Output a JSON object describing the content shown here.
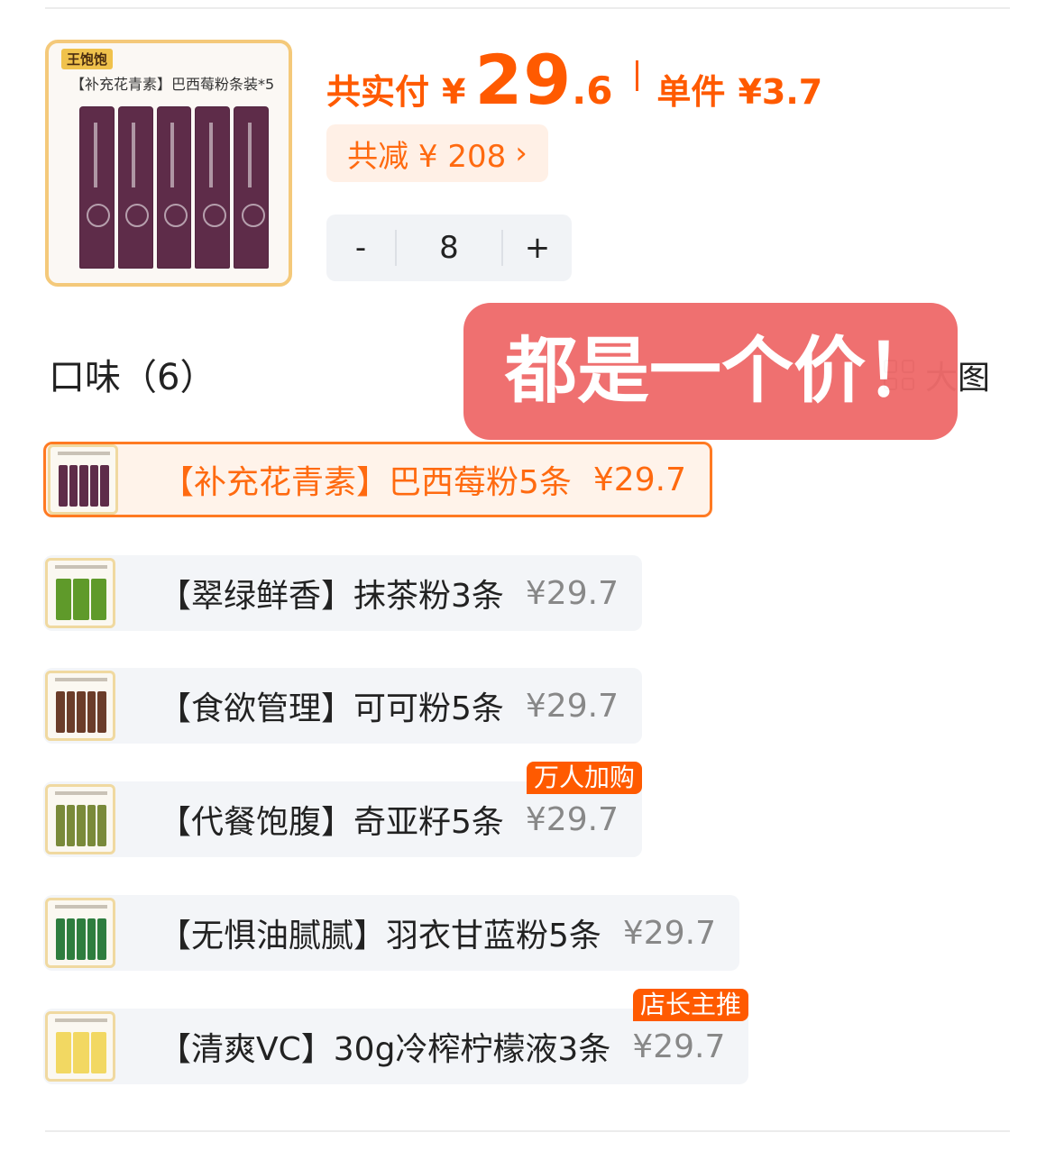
{
  "product": {
    "brand": "王饱饱",
    "image_caption": "【补充花青素】巴西莓粉条装*5",
    "pack_color": "#5e2c49"
  },
  "price": {
    "label": "共实付",
    "currency": "¥",
    "integer": "29",
    "decimal": ".6",
    "unit_label": "单件",
    "unit_price": "¥3.7",
    "accent": "#ff5a00"
  },
  "discount": {
    "text": "共减 ¥ 208",
    "chevron": "›"
  },
  "quantity": {
    "minus": "-",
    "value": "8",
    "plus": "+"
  },
  "flavors": {
    "title": "口味（6）",
    "big_image_label": "大图",
    "items": [
      {
        "name": "【补充花青素】巴西莓粉5条",
        "price": "¥29.7",
        "selected": true,
        "pack_color": "#5e2c49",
        "tag": ""
      },
      {
        "name": "【翠绿鲜香】抹茶粉3条",
        "price": "¥29.7",
        "selected": false,
        "pack_color": "#5f9a2a",
        "tag": ""
      },
      {
        "name": "【食欲管理】可可粉5条",
        "price": "¥29.7",
        "selected": false,
        "pack_color": "#6b3d2a",
        "tag": ""
      },
      {
        "name": "【代餐饱腹】奇亚籽5条",
        "price": "¥29.7",
        "selected": false,
        "pack_color": "#7a8a3a",
        "tag": "万人加购"
      },
      {
        "name": "【无惧油腻腻】羽衣甘蓝粉5条",
        "price": "¥29.7",
        "selected": false,
        "pack_color": "#2e7d3e",
        "tag": ""
      },
      {
        "name": "【清爽VC】30g冷榨柠檬液3条",
        "price": "¥29.7",
        "selected": false,
        "pack_color": "#f2d862",
        "tag": "店长主推"
      }
    ]
  },
  "overlay": {
    "text": "都是一个价！"
  }
}
